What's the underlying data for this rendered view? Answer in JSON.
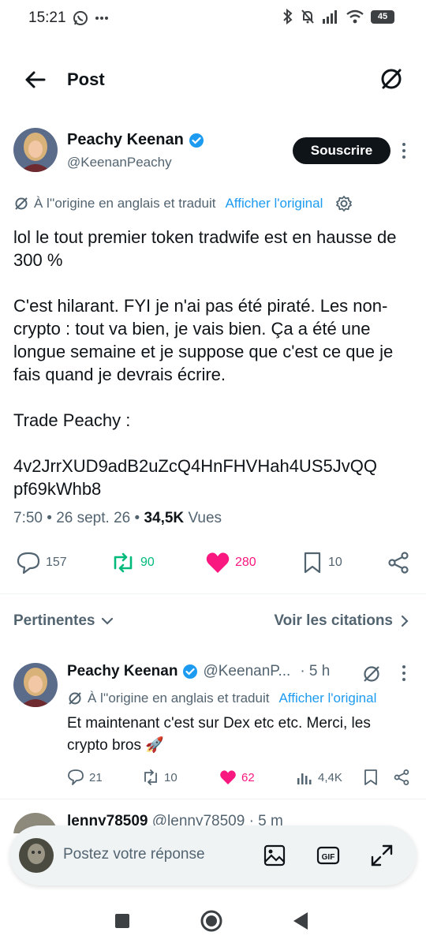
{
  "status_bar": {
    "time": "15:21",
    "battery": "45"
  },
  "header": {
    "title": "Post"
  },
  "post": {
    "author_name": "Peachy Keenan",
    "author_handle": "@KeenanPeachy",
    "subscribe_label": "Souscrire",
    "translation_note": "À l''origine en anglais et traduit",
    "show_original": "Afficher l'original",
    "paragraphs": [
      "lol le tout premier token tradwife est en hausse de 300 %",
      "C'est hilarant. FYI je n'ai pas été piraté. Les non-crypto : tout va bien, je vais bien. Ça a été une longue semaine et je suppose que c'est ce que je fais quand je devrais écrire.",
      "Trade Peachy :",
      "4v2JrrXUD9adB2uZcQ4HnFHVHah4US5JvQQ pf69kWhb8"
    ],
    "time": "7:50",
    "date": "26 sept. 26",
    "views_count": "34,5K",
    "views_label": "Vues",
    "stats": {
      "replies": "157",
      "reposts": "90",
      "likes": "280",
      "bookmarks": "10"
    }
  },
  "replies_header": {
    "sort_label": "Pertinentes",
    "quotes_label": "Voir les citations"
  },
  "reply": {
    "author_name": "Peachy Keenan",
    "author_handle": "@KeenanP...",
    "time": "· 5 h",
    "translation_note": "À l''origine en anglais et traduit",
    "show_original": "Afficher l'original",
    "text": "Et maintenant c'est sur Dex etc etc. Merci, les crypto bros 🚀",
    "stats": {
      "replies": "21",
      "reposts": "10",
      "likes": "62",
      "views": "4,4K"
    }
  },
  "next_reply": {
    "author_name": "lenny78509",
    "author_handle": "@lenny78509",
    "time": "· 5 m"
  },
  "compose": {
    "placeholder": "Postez votre réponse"
  },
  "colors": {
    "accent": "#1d9bf0",
    "like": "#f91880",
    "repost": "#00ba7c",
    "text": "#0f1419",
    "muted": "#536471"
  }
}
